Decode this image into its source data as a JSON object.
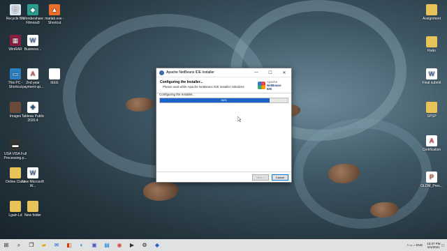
{
  "desktop_left": [
    {
      "label": "Recycle Bin",
      "icon": "recycle-bin-icon"
    },
    {
      "label": "Wondershare Filmora9",
      "icon": "filmora-icon"
    },
    {
      "label": "matlab.exe - Shortcut",
      "icon": "matlab-icon"
    },
    {
      "label": "WinRAR",
      "icon": "winrar-icon"
    },
    {
      "label": "Business...",
      "icon": "word-doc-icon"
    },
    {
      "label": "This PC - Shortcut",
      "icon": "this-pc-icon"
    },
    {
      "label": "2nd year payment up...",
      "icon": "pdf-icon"
    },
    {
      "label": "IEEE",
      "icon": "blank-file-icon"
    },
    {
      "label": "Images",
      "icon": "folder-icon"
    },
    {
      "label": "Tableau Public 2020.4",
      "icon": "tableau-icon"
    },
    {
      "label": "USA VISA Full Processing.p...",
      "icon": "pdf-file-icon"
    },
    {
      "label": "Online Class",
      "icon": "folder-icon"
    },
    {
      "label": "New Microsoft W...",
      "icon": "word-doc-icon"
    },
    {
      "label": "Lgain Ld",
      "icon": "folder-icon"
    },
    {
      "label": "New folder",
      "icon": "folder-icon"
    }
  ],
  "desktop_right": [
    {
      "label": "Assignment",
      "icon": "folder-icon"
    },
    {
      "label": "Ratio",
      "icon": "folder-icon"
    },
    {
      "label": "Final submit",
      "icon": "word-doc-icon"
    },
    {
      "label": "SPSP",
      "icon": "folder-icon"
    },
    {
      "label": "Certification",
      "icon": "pdf-icon"
    },
    {
      "label": "GLDM_Pres...",
      "icon": "presentation-icon"
    }
  ],
  "dialog": {
    "title": "Apache NetBeans IDE Installer",
    "heading": "Configuring the Installer...",
    "subheading": "Please wait while Apache NetBeans IDE installer initializes",
    "logo_top": "Apache",
    "logo_bottom": "NetBeans IDE",
    "status": "Configuring the Installer...",
    "progress_percent": 86,
    "progress_label": "86%",
    "next_label": "Next >",
    "cancel_label": "Cancel",
    "minimize": "—",
    "maximize": "☐",
    "close": "✕"
  },
  "taskbar": {
    "icons": [
      "windows-start-icon",
      "search-icon",
      "task-view-icon",
      "file-explorer-icon",
      "mail-icon",
      "office-icon",
      "edge-icon",
      "teams-icon",
      "store-icon",
      "chrome-icon",
      "terminal-icon",
      "settings-icon",
      "netbeans-icon"
    ],
    "language": "ENG",
    "time": "10:37 PM",
    "date": "5/1/2021"
  }
}
